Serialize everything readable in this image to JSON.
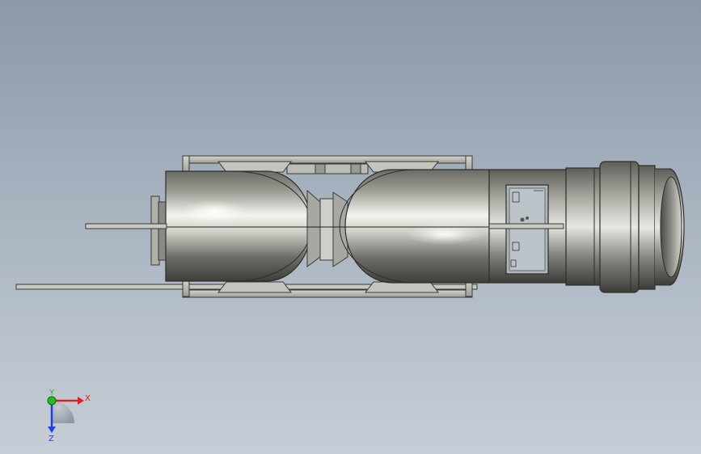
{
  "viewport": {
    "background_top": "#8c98a8",
    "background_bottom": "#c6cdd6"
  },
  "model": {
    "body_color": "#9a9a94",
    "frame_color": "#b9b9b4",
    "panel_color": "#aeb6bd"
  },
  "triad": {
    "x_label": "X",
    "y_label": "Y",
    "z_label": "Z",
    "x_color": "#e02020",
    "y_color": "#20c020",
    "z_color": "#2040e0"
  }
}
